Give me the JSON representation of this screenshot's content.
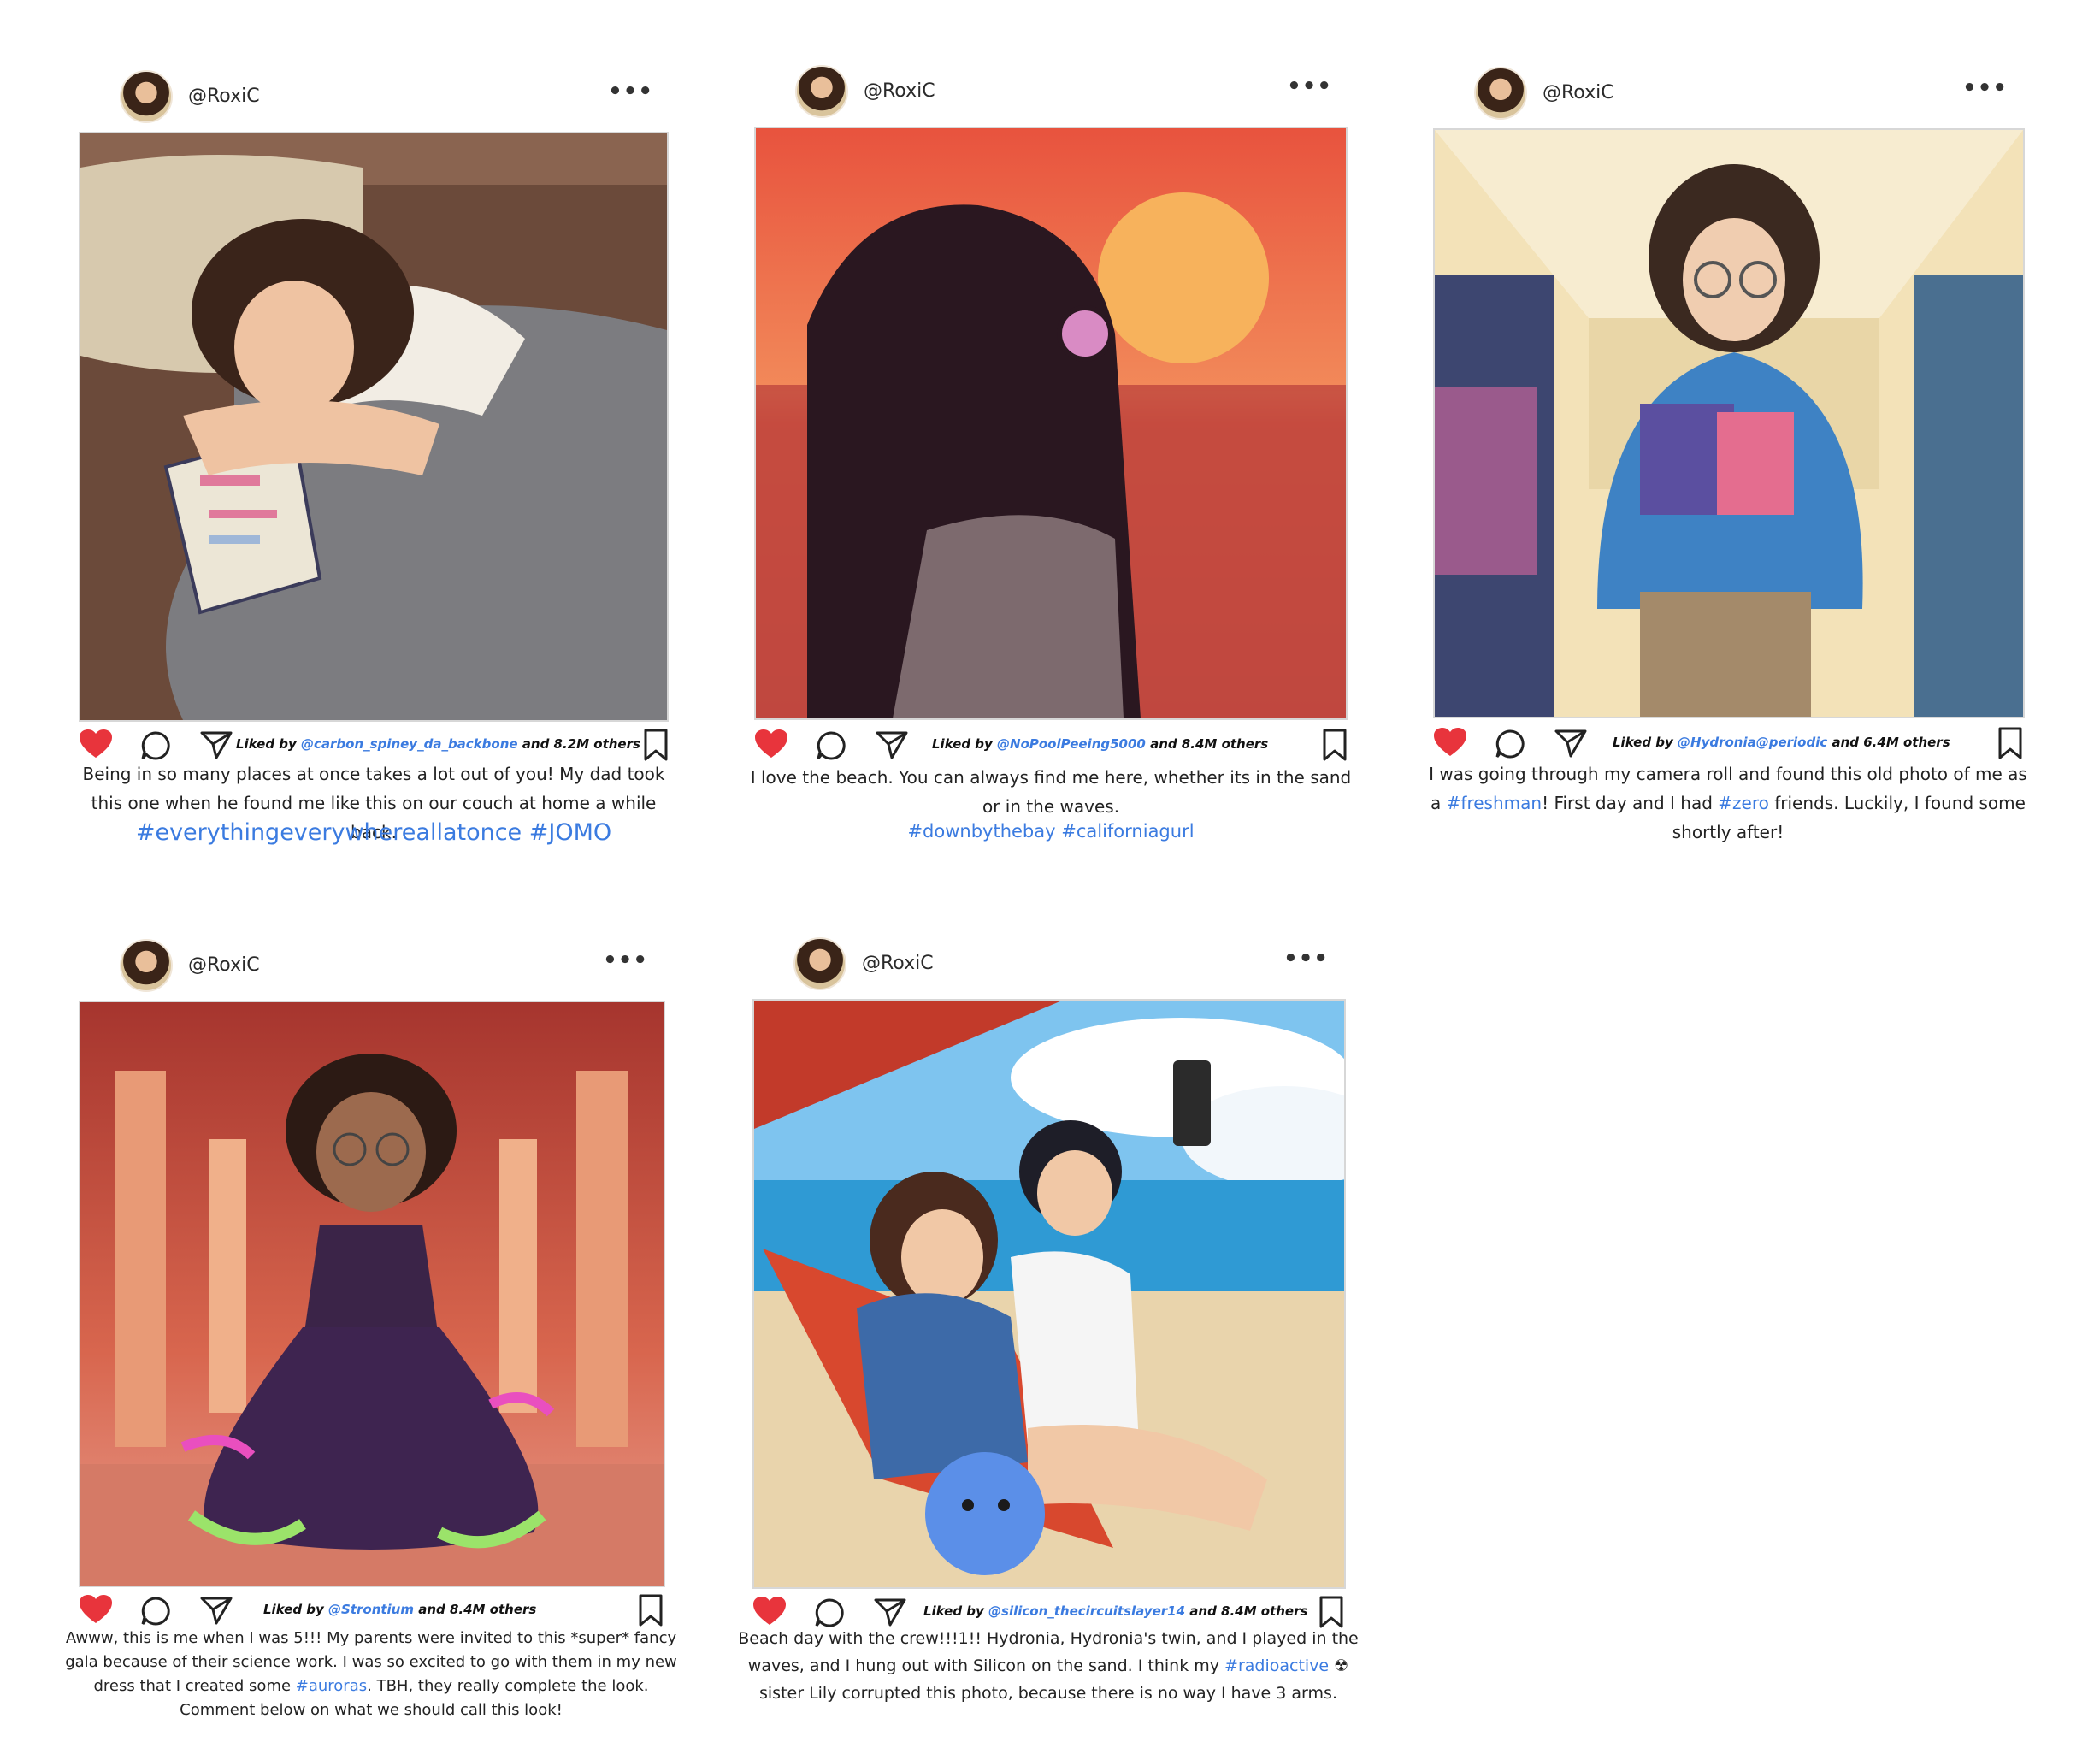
{
  "posts": [
    {
      "user": "@RoxiC",
      "more": "•••",
      "liked_prefix": "Liked by ",
      "liked_user": "@carbon_spiney_da_backbone",
      "liked_suffix": " and 8.2M others",
      "caption_1": "Being in so many places at once takes a lot out of you! My dad took this one when he found me like this on our couch at home a while back.",
      "hashtags": "#everythingeverywhereallatonce  #JOMO"
    },
    {
      "user": "@RoxiC",
      "more": "•••",
      "liked_prefix": "Liked by ",
      "liked_user": "@NoPoolPeeing5000",
      "liked_suffix": " and 8.4M others",
      "caption_1": "I love the beach. You can always find me here, whether its in the sand or in the waves.",
      "hashtags": "#downbythebay #californiagurl"
    },
    {
      "user": "@RoxiC",
      "more": "•••",
      "liked_prefix": "Liked by ",
      "liked_user": "@Hydronia@periodic",
      "liked_suffix": " and 6.4M others",
      "caption_a": "I was going through my camera roll and found this old photo of me as a ",
      "tag_a": "#freshman",
      "caption_b": "! First day and I had ",
      "tag_b": "#zero",
      "caption_c": " friends. Luckily, I found some shortly after!"
    },
    {
      "user": "@RoxiC",
      "more": "•••",
      "liked_prefix": "Liked by ",
      "liked_user": "@Strontium",
      "liked_suffix": " and 8.4M others",
      "caption_a": "Awww, this is me when I was 5!!! My parents were invited to this *super* fancy gala because of their science work. I was so excited to go with them in my new dress that I created some ",
      "tag_a": "#auroras",
      "caption_b": ". TBH, they really complete the look. Comment below on what we should call this look!"
    },
    {
      "user": "@RoxiC",
      "more": "•••",
      "liked_prefix": "Liked by ",
      "liked_user": "@silicon_thecircuitslayer14",
      "liked_suffix": " and 8.4M others",
      "caption_a": "Beach day with the crew!!!1!! Hydronia, Hydronia's twin, and I played in the waves, and I hung out with Silicon on the sand. I think my ",
      "tag_a": "#radioactive",
      "caption_b": " ☢ sister Lily corrupted this photo, because there is no way  I have 3 arms."
    }
  ]
}
